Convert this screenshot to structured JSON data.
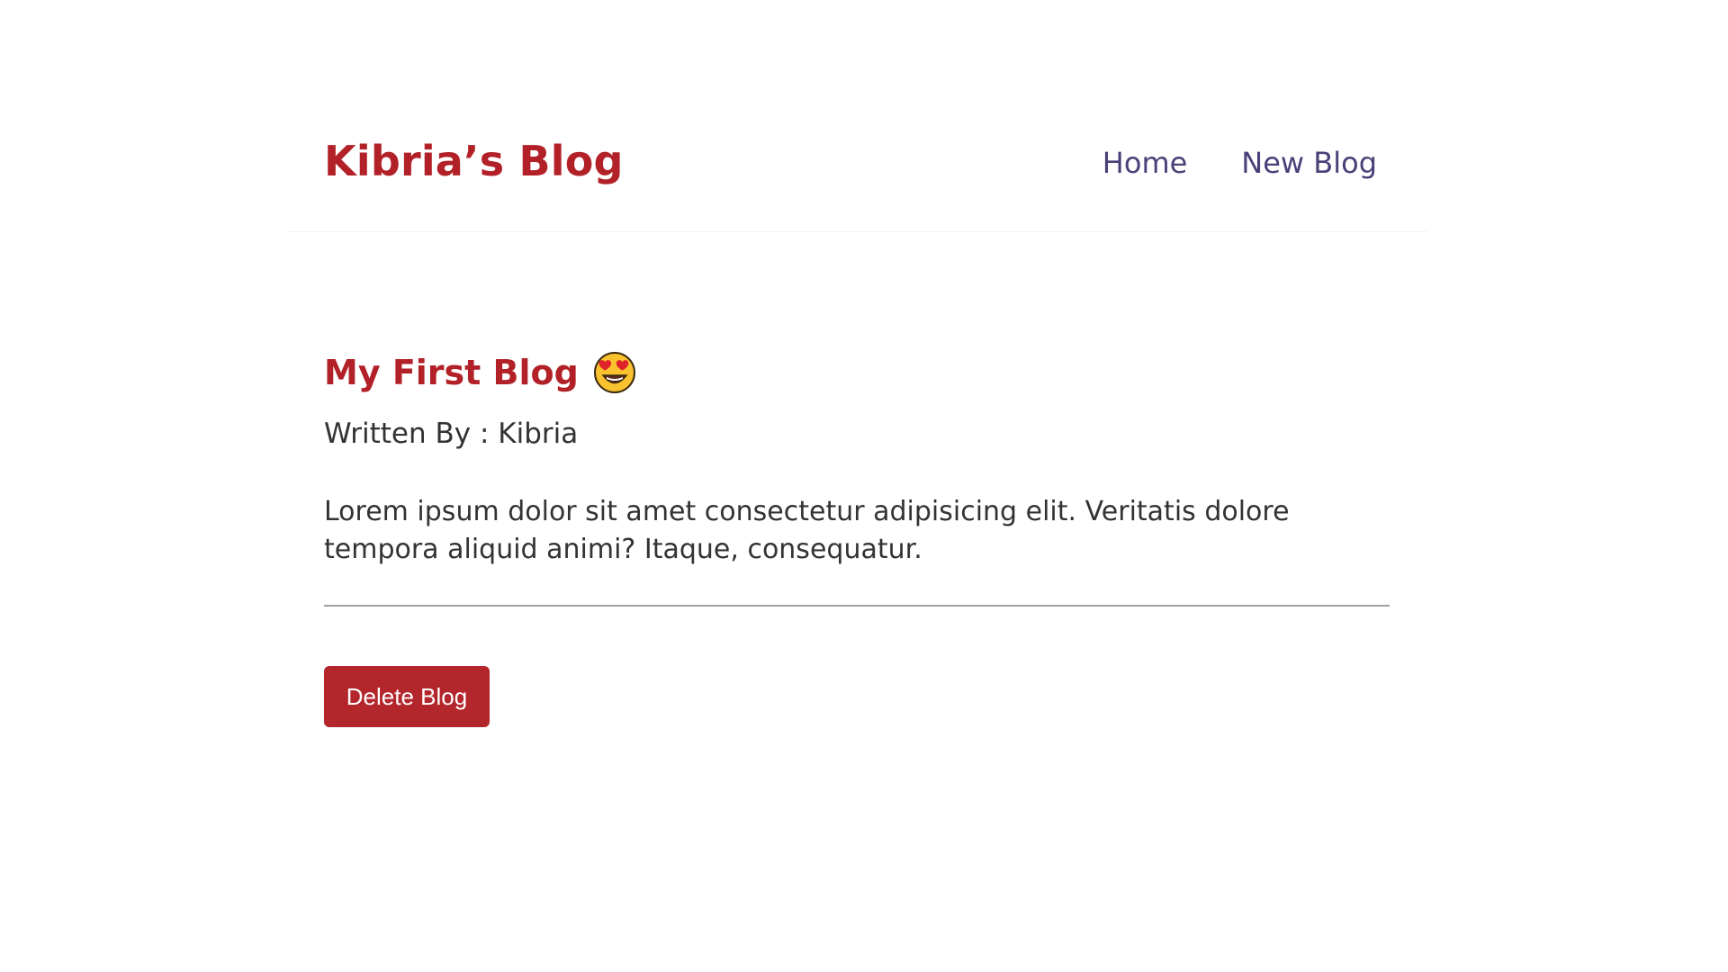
{
  "header": {
    "brand": "Kibria’s Blog",
    "nav": [
      {
        "label": "Home"
      },
      {
        "label": "New Blog"
      }
    ]
  },
  "blog": {
    "title": "My First Blog",
    "emoji_icon": "heart-eyes-emoji-icon",
    "author_line": "Written By : Kibria",
    "body": "Lorem ipsum dolor sit amet consectetur adipisicing elit. Veritatis dolore tempora aliquid animi? Itaque, consequatur.",
    "delete_label": "Delete Blog"
  },
  "colors": {
    "accent": "#b22128",
    "nav_text": "#4b3f78",
    "button_bg": "#b3262c"
  }
}
